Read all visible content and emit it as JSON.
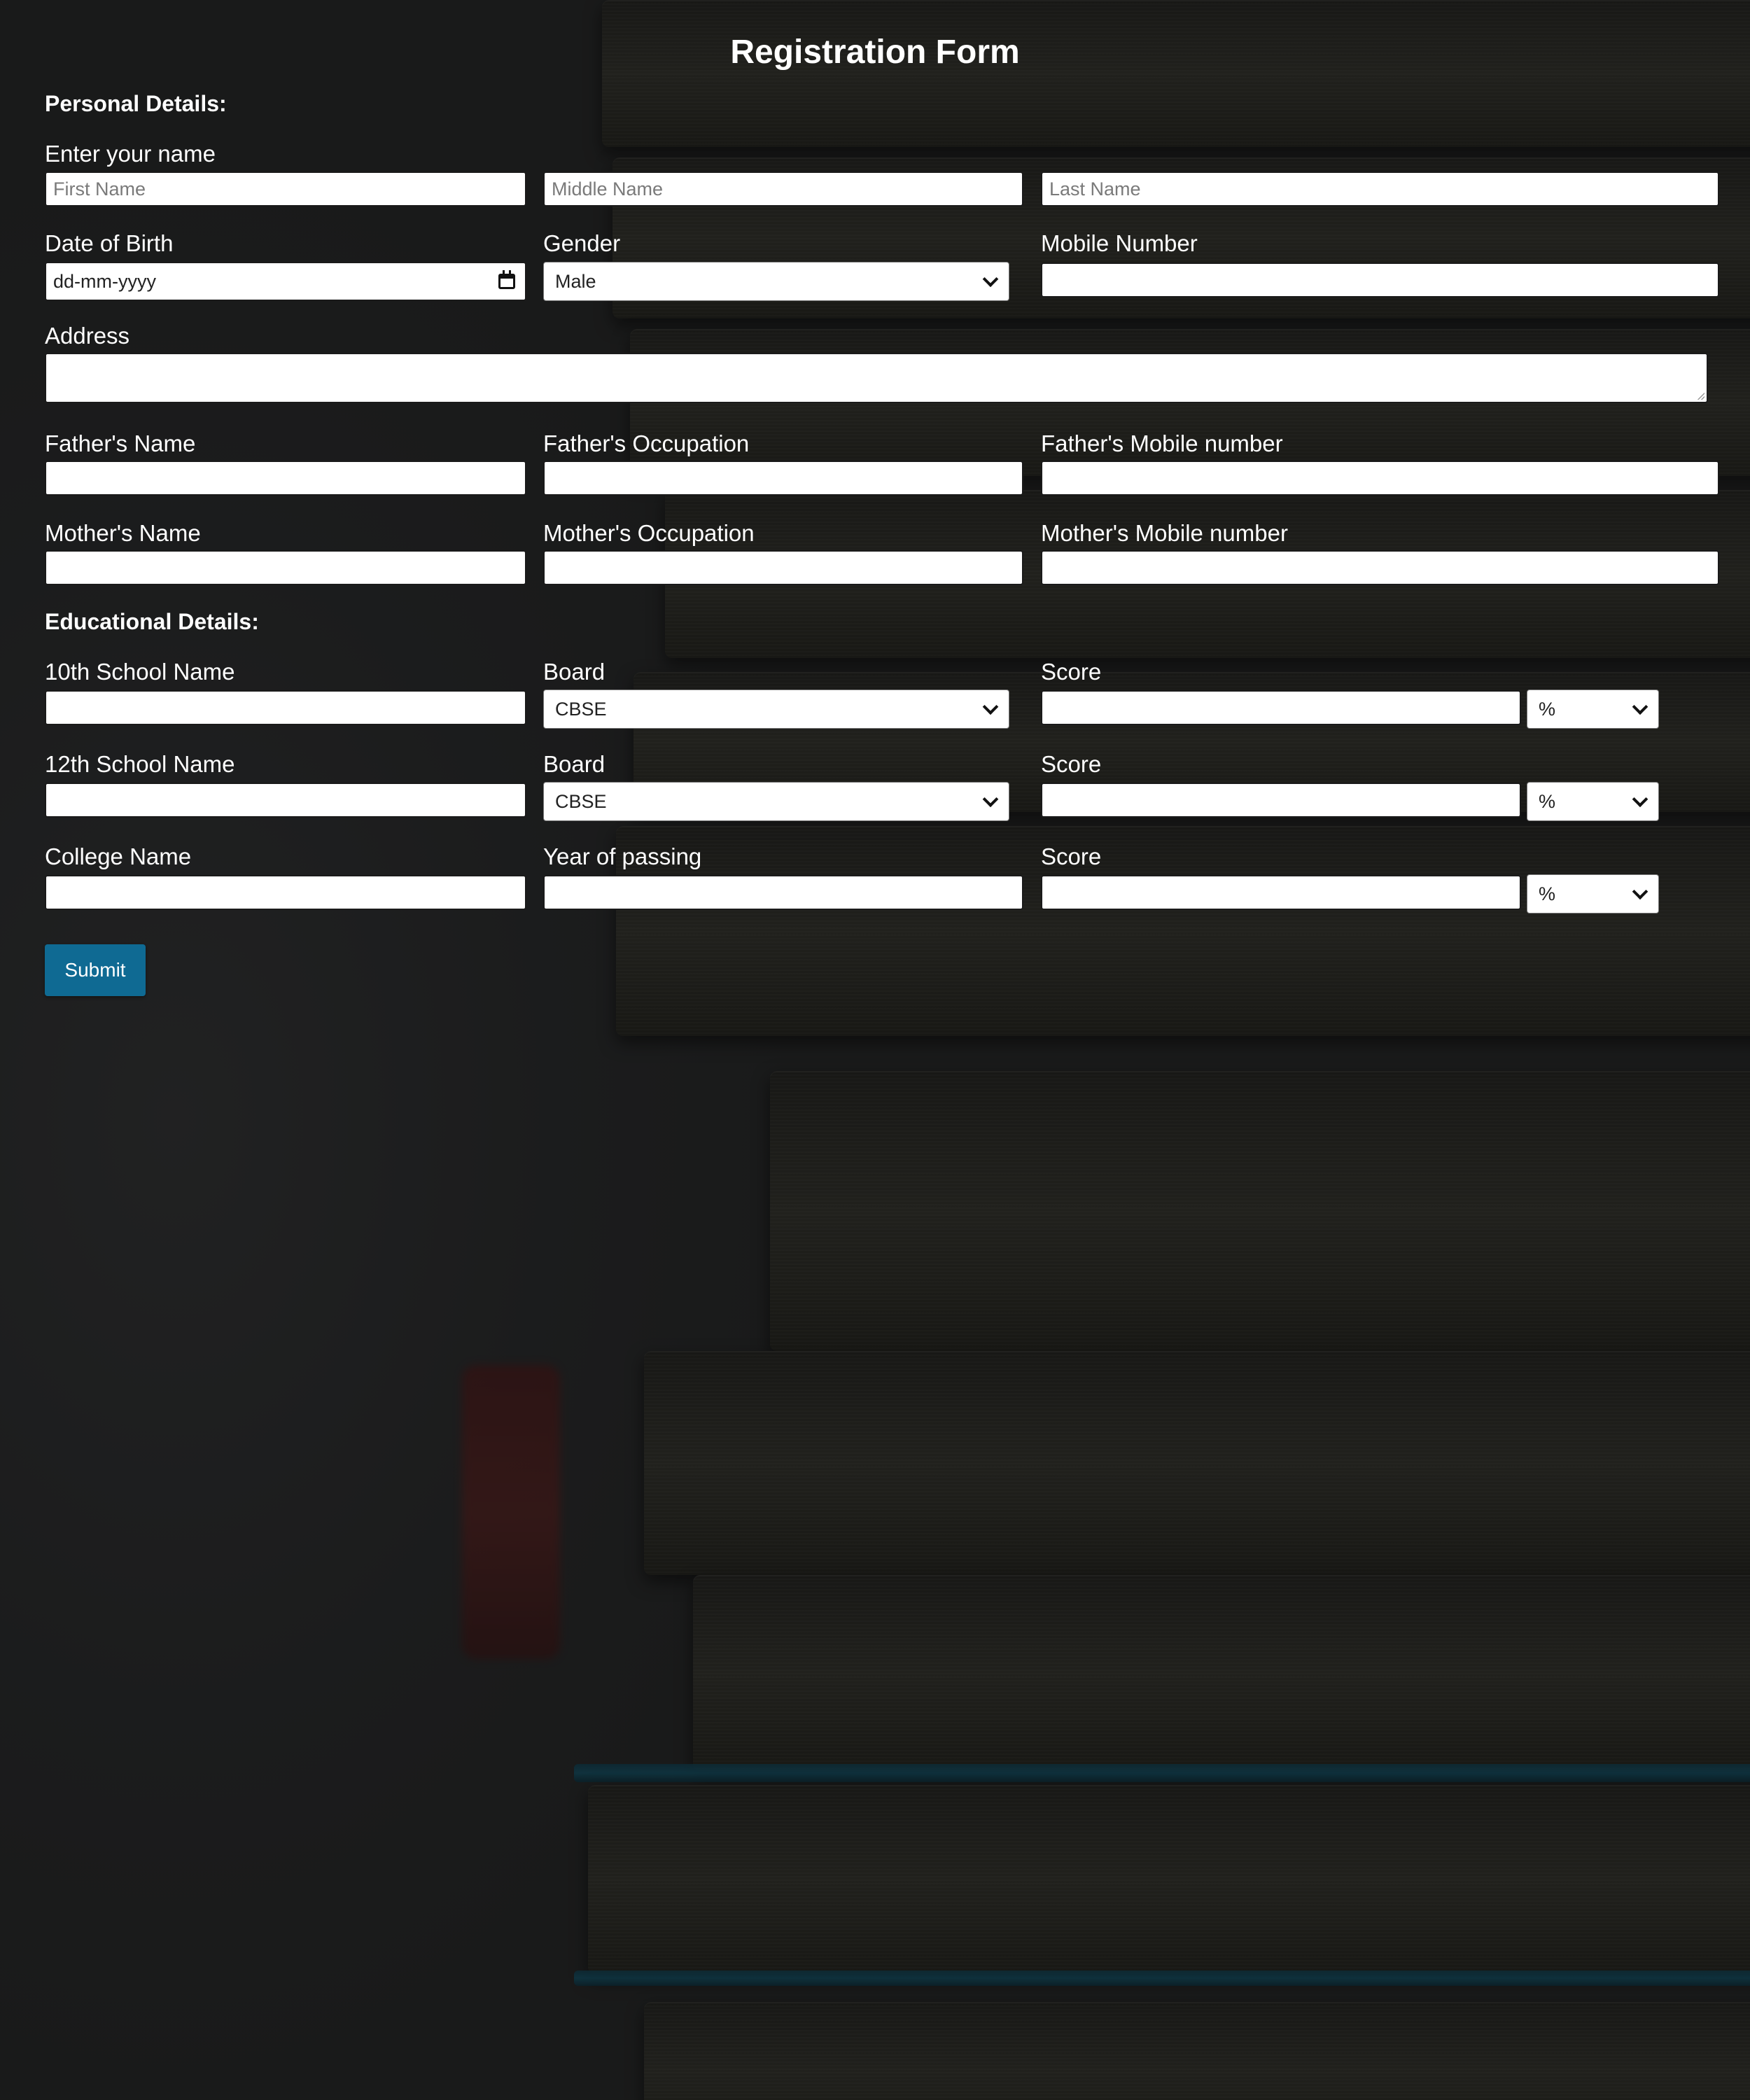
{
  "form": {
    "title": "Registration Form",
    "submit_label": "Submit"
  },
  "personal": {
    "heading": "Personal Details:",
    "name_label": "Enter your name",
    "first_name_placeholder": "First Name",
    "middle_name_placeholder": "Middle Name",
    "last_name_placeholder": "Last Name",
    "dob_label": "Date of Birth",
    "dob_value": "dd-mm-yyyy",
    "gender_label": "Gender",
    "gender_value": "Male",
    "mobile_label": "Mobile Number",
    "address_label": "Address",
    "father_name_label": "Father's Name",
    "father_occupation_label": "Father's Occupation",
    "father_mobile_label": "Father's Mobile number",
    "mother_name_label": "Mother's Name",
    "mother_occupation_label": "Mother's Occupation",
    "mother_mobile_label": "Mother's Mobile number"
  },
  "education": {
    "heading": "Educational Details:",
    "school10_label": "10th School Name",
    "board10_label": "Board",
    "board10_value": "CBSE",
    "score10_label": "Score",
    "score10_unit": "%",
    "school12_label": "12th School Name",
    "board12_label": "Board",
    "board12_value": "CBSE",
    "score12_label": "Score",
    "score12_unit": "%",
    "college_label": "College Name",
    "year_label": "Year of passing",
    "score_college_label": "Score",
    "score_college_unit": "%"
  }
}
